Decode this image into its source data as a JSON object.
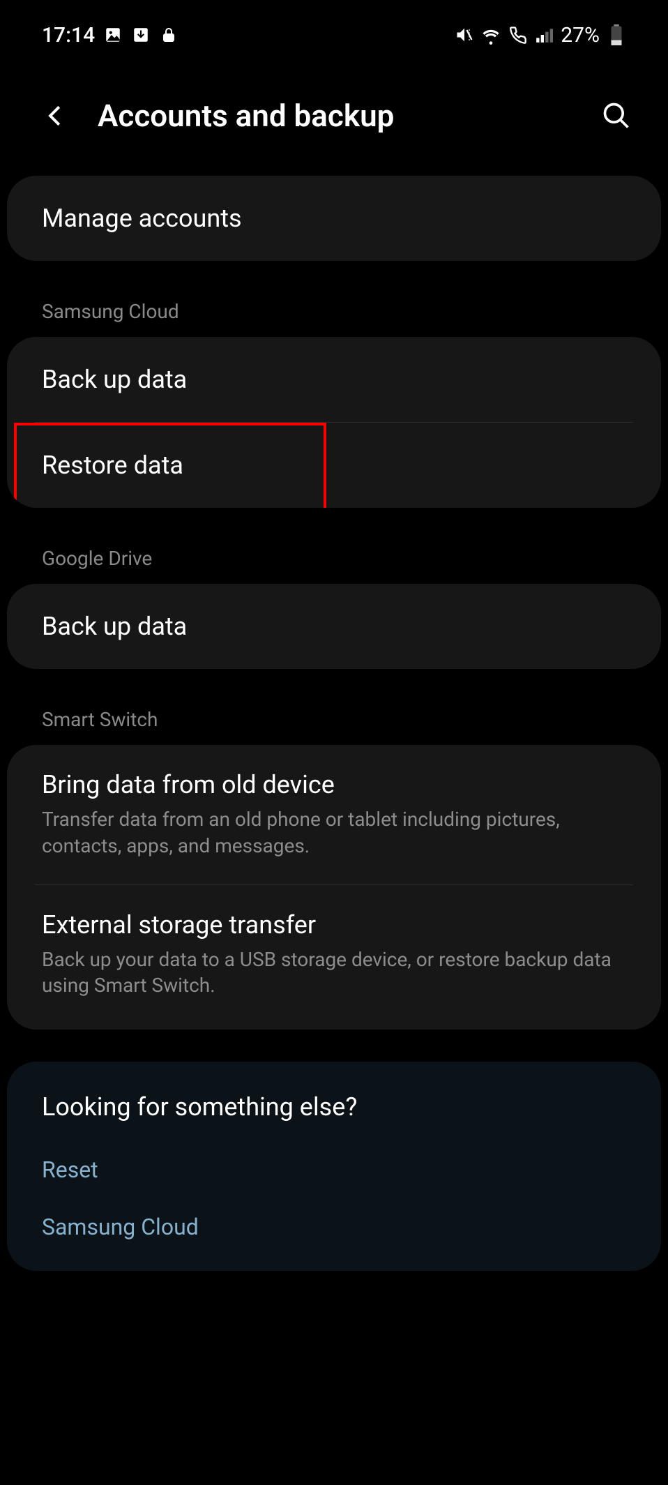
{
  "status": {
    "time": "17:14",
    "battery": "27%"
  },
  "header": {
    "title": "Accounts and backup"
  },
  "manage_accounts": {
    "label": "Manage accounts"
  },
  "sections": {
    "samsung_cloud": {
      "header": "Samsung Cloud",
      "backup": "Back up data",
      "restore": "Restore data"
    },
    "google_drive": {
      "header": "Google Drive",
      "backup": "Back up data"
    },
    "smart_switch": {
      "header": "Smart Switch",
      "bring": {
        "title": "Bring data from old device",
        "sub": "Transfer data from an old phone or tablet including pictures, contacts, apps, and messages."
      },
      "external": {
        "title": "External storage transfer",
        "sub": "Back up your data to a USB storage device, or restore backup data using Smart Switch."
      }
    }
  },
  "suggestions": {
    "title": "Looking for something else?",
    "reset": "Reset",
    "samsung_cloud": "Samsung Cloud"
  }
}
